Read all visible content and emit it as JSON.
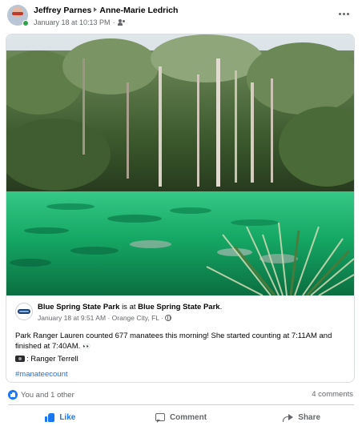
{
  "post": {
    "author": "Jeffrey Parnes",
    "recipient": "Anne-Marie Ledrich",
    "timestamp": "January 18 at 10:13 PM",
    "audience_icon": "friends-icon",
    "more_icon": "more-options-icon"
  },
  "shared_post": {
    "page_name": "Blue Spring State Park",
    "is_at": "is at",
    "location_name": "Blue Spring State Park",
    "period": ".",
    "timestamp": "January 18 at 9:51 AM",
    "place": "Orange City, FL",
    "audience_icon": "globe-icon",
    "text": "Park Ranger Lauren counted 677 manatees this morning! She started counting at 7:11AM and finished at 7:40AM.",
    "text_emoji": "👀",
    "credit": ": Ranger Terrell",
    "hashtag": "#manateecount",
    "photo_description_icon": "photo-manatees-spring"
  },
  "reactions": {
    "summary": "You and 1 other",
    "comments": "4 comments",
    "icon": "like-reaction-icon"
  },
  "actions": {
    "like": "Like",
    "comment": "Comment",
    "share": "Share"
  },
  "colors": {
    "facebook_blue": "#1877f2",
    "secondary_text": "#65676b",
    "link": "#216fdb",
    "online": "#31a24c",
    "water": "#1faf6a"
  }
}
